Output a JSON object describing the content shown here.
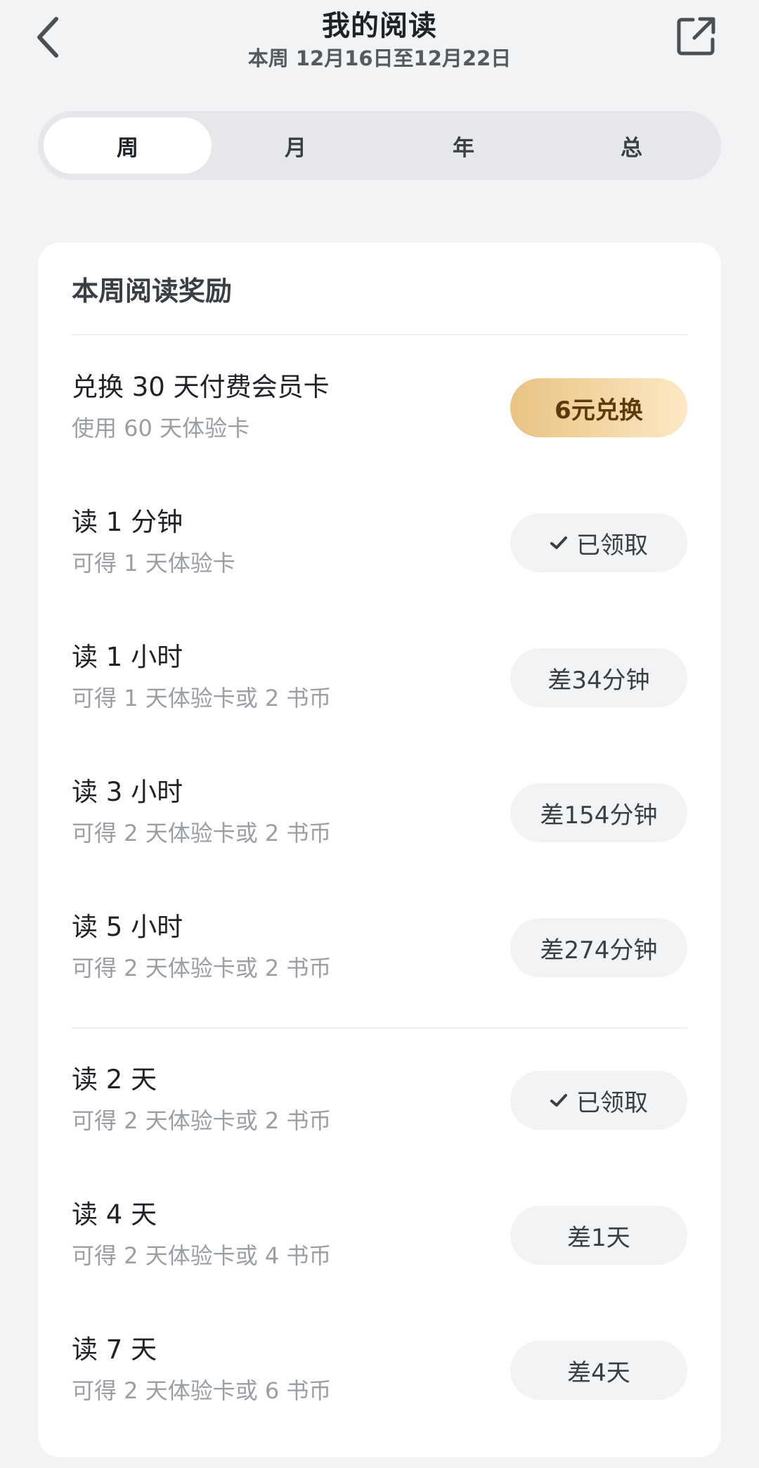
{
  "header": {
    "title": "我的阅读",
    "subtitle": "本周 12月16日至12月22日"
  },
  "tabs": [
    {
      "label": "周",
      "active": true
    },
    {
      "label": "月",
      "active": false
    },
    {
      "label": "年",
      "active": false
    },
    {
      "label": "总",
      "active": false
    }
  ],
  "rewards": {
    "title": "本周阅读奖励",
    "items": [
      {
        "title": "兑换 30 天付费会员卡",
        "subtitle": "使用 60 天体验卡",
        "action": "6元兑换",
        "style": "gold"
      },
      {
        "title": "读 1 分钟",
        "subtitle": "可得 1 天体验卡",
        "action": "已领取",
        "style": "claimed"
      },
      {
        "title": "读 1 小时",
        "subtitle": "可得 1 天体验卡或 2 书币",
        "action": "差34分钟",
        "style": "pending"
      },
      {
        "title": "读 3 小时",
        "subtitle": "可得 2 天体验卡或 2 书币",
        "action": "差154分钟",
        "style": "pending"
      },
      {
        "title": "读 5 小时",
        "subtitle": "可得 2 天体验卡或 2 书币",
        "action": "差274分钟",
        "style": "pending"
      },
      {
        "title": "读 2 天",
        "subtitle": "可得 2 天体验卡或 2 书币",
        "action": "已领取",
        "style": "claimed"
      },
      {
        "title": "读 4 天",
        "subtitle": "可得 2 天体验卡或 4 书币",
        "action": "差1天",
        "style": "pending"
      },
      {
        "title": "读 7 天",
        "subtitle": "可得 2 天体验卡或 6 书币",
        "action": "差4天",
        "style": "pending"
      }
    ]
  },
  "colors": {
    "background": "#f2f3f5",
    "gold_start": "#e9c383",
    "gold_end": "#fde8c4",
    "gold_text": "#5c3a0d"
  },
  "icons": {
    "back": "chevron-left-icon",
    "share": "share-external-icon",
    "check": "check-icon"
  }
}
